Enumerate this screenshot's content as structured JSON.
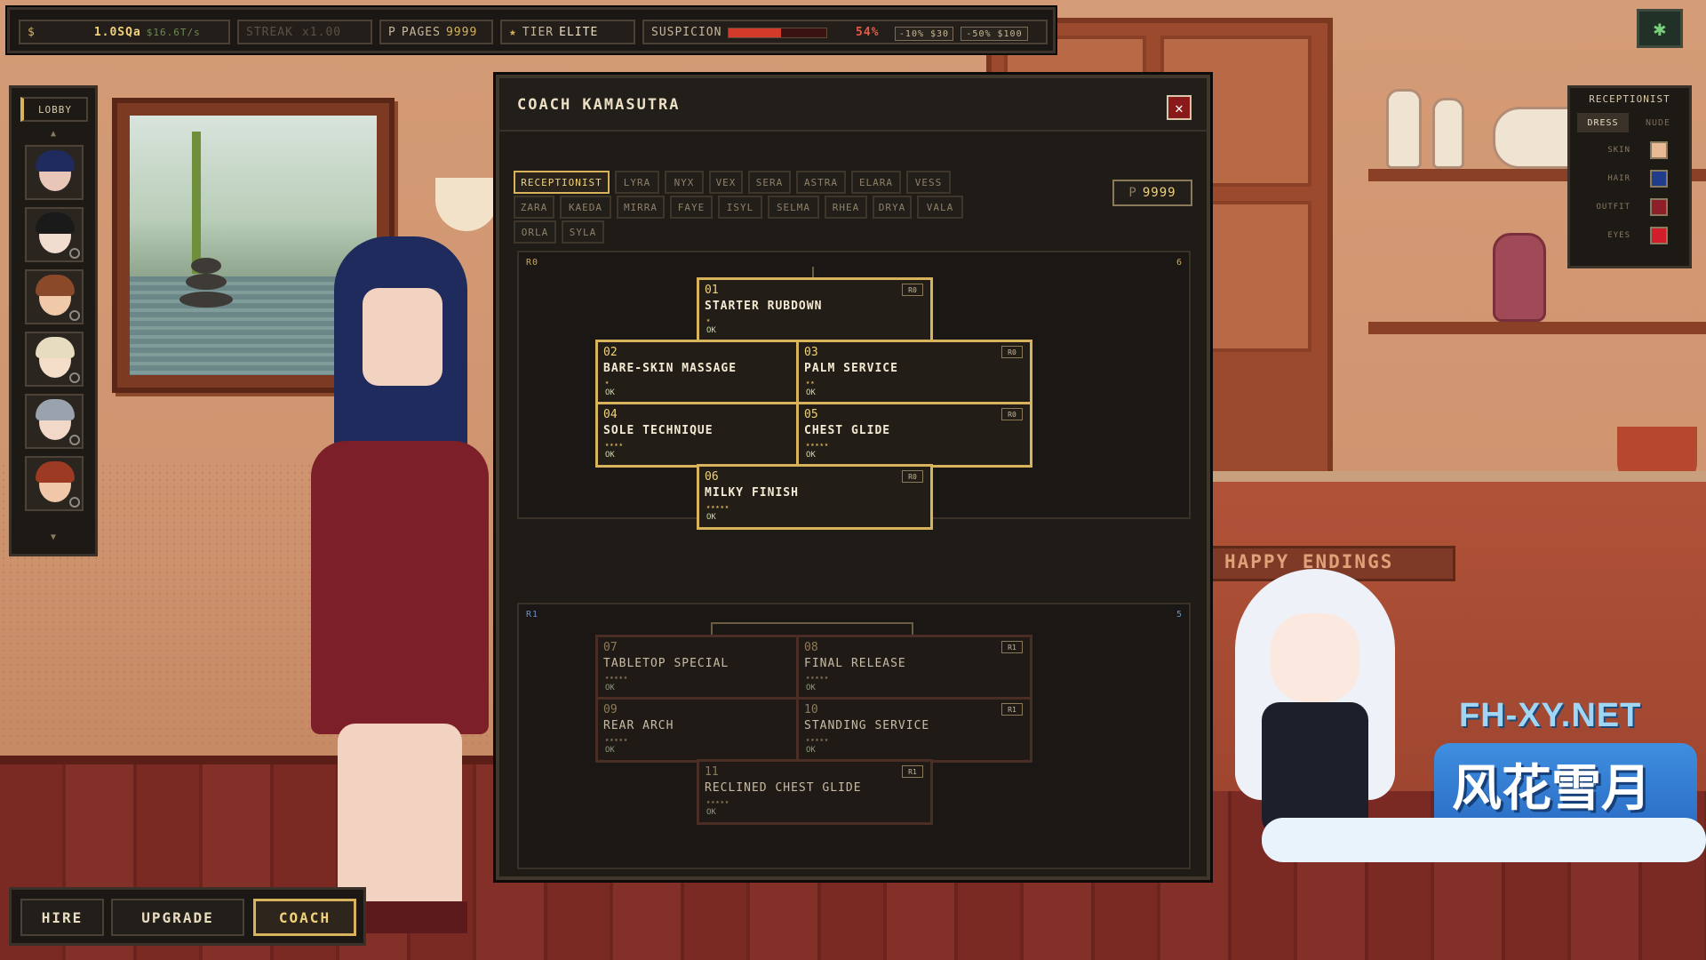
{
  "hud": {
    "money_symbol": "$",
    "money": "1.0SQa",
    "rate": "$16.6T/s",
    "streak_label": "STREAK",
    "streak_value": "x1.00",
    "pages_prefix": "P",
    "pages_label": "PAGES",
    "pages_value": "9999",
    "tier_icon": "★",
    "tier_label": "TIER",
    "tier_value": "ELITE",
    "suspicion_label": "SUSPICION",
    "suspicion_percent": "54%",
    "suspicion_fraction": 0.54,
    "reduce_small": "-10% $30",
    "reduce_large": "-50% $100"
  },
  "settings": {
    "icon": "gear-icon",
    "glyph": "✱"
  },
  "lobby": {
    "title": "LOBBY",
    "up": "▲",
    "down": "▼",
    "portraits": [
      {
        "hair": "#1f2b5c",
        "skin": "#e8c6b8",
        "badge": false
      },
      {
        "hair": "#1a1a1a",
        "skin": "#f1ddd0",
        "badge": true
      },
      {
        "hair": "#8a4a2a",
        "skin": "#f0c9a8",
        "badge": true
      },
      {
        "hair": "#e8dcc0",
        "skin": "#f4ddc9",
        "badge": true
      },
      {
        "hair": "#9aa3ad",
        "skin": "#f1d8c8",
        "badge": true
      },
      {
        "hair": "#9c3a24",
        "skin": "#f0c7a8",
        "badge": true
      }
    ]
  },
  "customize": {
    "title": "RECEPTIONIST",
    "tabs": [
      "DRESS",
      "NUDE"
    ],
    "rows": [
      {
        "label": "SKIN",
        "color": "#e9b894"
      },
      {
        "label": "HAIR",
        "color": "#1f3d8a"
      },
      {
        "label": "OUTFIT",
        "color": "#8e1f28"
      },
      {
        "label": "EYES",
        "color": "#d21e2a"
      }
    ]
  },
  "modal": {
    "title": "COACH KAMASUTRA",
    "close": "✕",
    "tabs_row1": [
      "RECEPTIONIST",
      "LYRA",
      "NYX",
      "VEX",
      "SERA",
      "ASTRA",
      "ELARA",
      "VESS"
    ],
    "tabs_row2": [
      "ZARA",
      "KAEDA",
      "MIRRA",
      "FAYE",
      "ISYL",
      "SELMA",
      "RHEA",
      "DRYA",
      "VALA"
    ],
    "tabs_row3": [
      "ORLA",
      "SYLA"
    ],
    "points_prefix": "P",
    "points_value": "9999",
    "ranks": [
      {
        "label": "R0",
        "count": "6",
        "nodes": [
          {
            "num": "01",
            "name": "STARTER RUBDOWN",
            "tag": "R0",
            "stars": "★",
            "status": "OK"
          },
          {
            "num": "02",
            "name": "BARE-SKIN MASSAGE",
            "tag": "R0",
            "stars": "★",
            "status": "OK"
          },
          {
            "num": "03",
            "name": "PALM SERVICE",
            "tag": "R0",
            "stars": "★★",
            "status": "OK"
          },
          {
            "num": "04",
            "name": "SOLE TECHNIQUE",
            "tag": "R0",
            "stars": "★★★★",
            "status": "OK"
          },
          {
            "num": "05",
            "name": "CHEST GLIDE",
            "tag": "R0",
            "stars": "★★★★★",
            "status": "OK"
          },
          {
            "num": "06",
            "name": "MILKY FINISH",
            "tag": "R0",
            "stars": "★★★★★",
            "status": "OK"
          }
        ]
      },
      {
        "label": "R1",
        "count": "5",
        "nodes": [
          {
            "num": "07",
            "name": "TABLETOP SPECIAL",
            "tag": "R1",
            "stars": "★★★★★",
            "status": "OK"
          },
          {
            "num": "08",
            "name": "FINAL RELEASE",
            "tag": "R1",
            "stars": "★★★★★",
            "status": "OK"
          },
          {
            "num": "09",
            "name": "REAR ARCH",
            "tag": "R1",
            "stars": "★★★★★",
            "status": "OK"
          },
          {
            "num": "10",
            "name": "STANDING SERVICE",
            "tag": "R1",
            "stars": "★★★★★",
            "status": "OK"
          },
          {
            "num": "11",
            "name": "RECLINED CHEST GLIDE",
            "tag": "R1",
            "stars": "★★★★★",
            "status": "OK"
          }
        ]
      }
    ]
  },
  "actions": {
    "hire": "HIRE",
    "upgrade": "UPGRADE",
    "coach": "COACH"
  },
  "scene": {
    "sign": "HAPPY ENDINGS",
    "watermark_url": "FH-XY.NET",
    "watermark_cn": "风花雪月"
  }
}
